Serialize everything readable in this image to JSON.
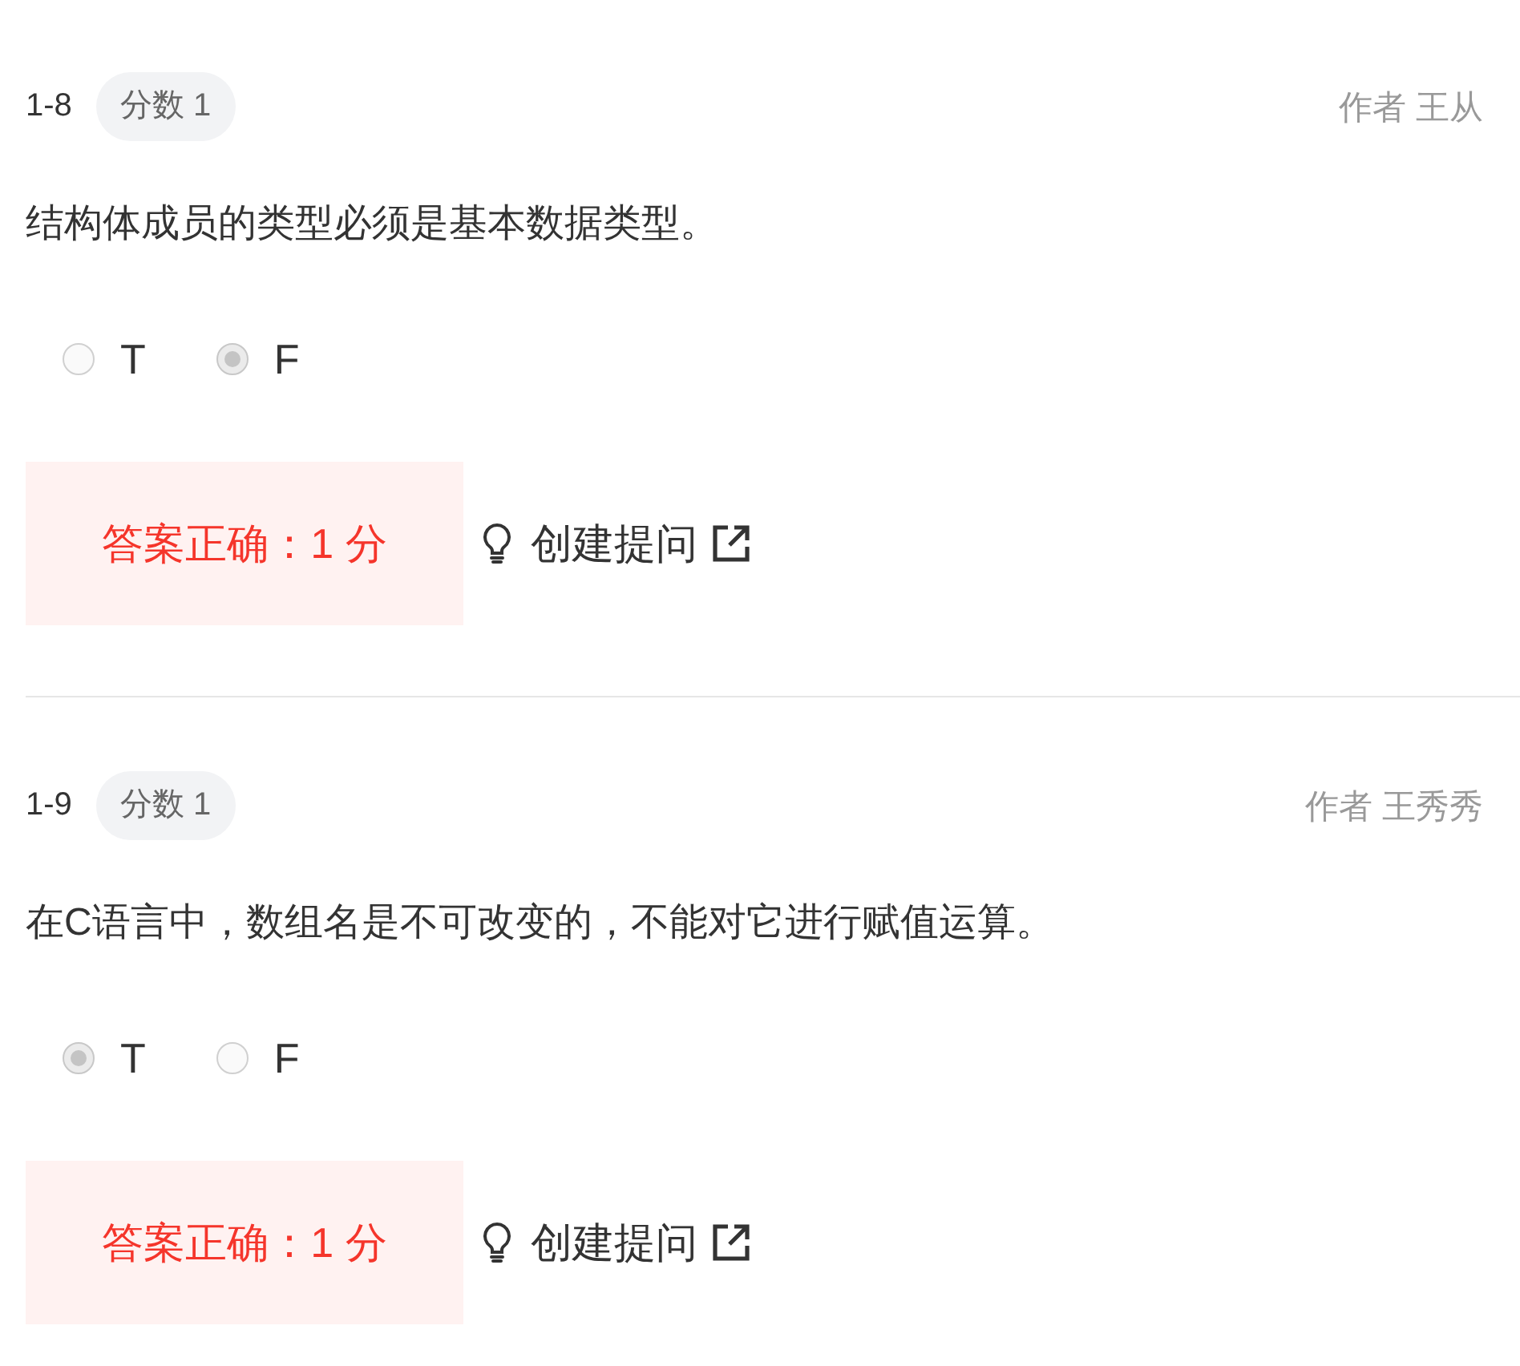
{
  "questions": [
    {
      "number": "1-8",
      "score_badge": "分数 1",
      "author": "作者 王从",
      "text": "结构体成员的类型必须是基本数据类型。",
      "options": [
        {
          "label": "T",
          "selected": false
        },
        {
          "label": "F",
          "selected": true
        }
      ],
      "result": "答案正确：1 分",
      "ask_link": "创建提问"
    },
    {
      "number": "1-9",
      "score_badge": "分数 1",
      "author": "作者 王秀秀",
      "text": "在C语言中，数组名是不可改变的，不能对它进行赋值运算。",
      "options": [
        {
          "label": "T",
          "selected": true
        },
        {
          "label": "F",
          "selected": false
        }
      ],
      "result": "答案正确：1 分",
      "ask_link": "创建提问"
    }
  ]
}
